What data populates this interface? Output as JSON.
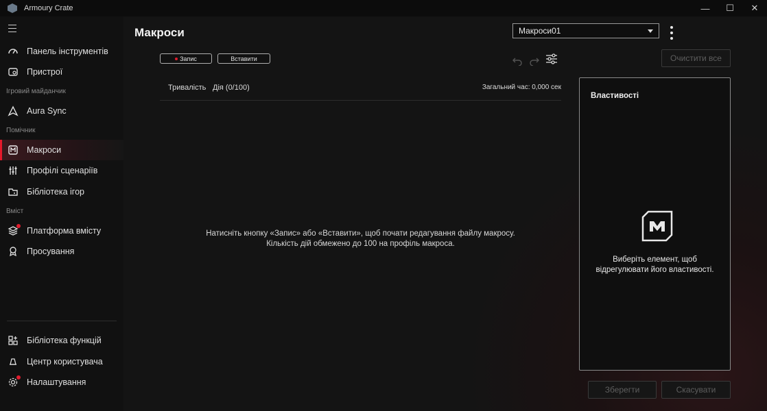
{
  "window": {
    "title": "Armoury Crate",
    "controls": [
      "—",
      "☐",
      "✕"
    ]
  },
  "sidebar": {
    "items_top": [
      {
        "label": "Панель інструментів",
        "icon": "dashboard-icon"
      },
      {
        "label": "Пристрої",
        "icon": "device-icon"
      }
    ],
    "section_playground": "Ігровий майданчик",
    "item_aura": {
      "label": "Aura Sync",
      "icon": "aura-icon"
    },
    "section_assistant": "Помічник",
    "items_assistant": [
      {
        "label": "Макроси",
        "icon": "macro-icon",
        "active": true
      },
      {
        "label": "Профілі сценаріїв",
        "icon": "scenario-icon"
      },
      {
        "label": "Бібліотека ігор",
        "icon": "game-library-icon"
      }
    ],
    "section_content": "Вміст",
    "items_content": [
      {
        "label": "Платформа вмісту",
        "icon": "layers-icon",
        "badge": true
      },
      {
        "label": "Просування",
        "icon": "promotion-icon"
      }
    ],
    "items_bottom": [
      {
        "label": "Бібліотека функцій",
        "icon": "feature-library-icon"
      },
      {
        "label": "Центр користувача",
        "icon": "user-center-icon"
      },
      {
        "label": "Налаштування",
        "icon": "gear-icon",
        "badge": true
      }
    ],
    "accent_color": "#e6192b"
  },
  "main": {
    "title": "Макроси",
    "profile_select": {
      "value": "Макроси01"
    },
    "record_button": "Запис",
    "insert_button": "Вставити",
    "clear_all_button": "Очистити все",
    "list": {
      "col_duration": "Тривалість",
      "col_action": "Дія (0/100)",
      "total_time": "Загальний час:  0,000 сек"
    },
    "empty_line1": "Натисніть кнопку «Запис» або «Вставити», щоб почати редагування файлу макросу.",
    "empty_line2": "Кількість дій обмежено до 100 на профіль макроса."
  },
  "properties": {
    "title": "Властивості",
    "hint_line1": "Виберіть елемент, щоб",
    "hint_line2": "відрегулювати його властивості."
  },
  "footer": {
    "save_button": "Зберегти",
    "cancel_button": "Скасувати"
  }
}
